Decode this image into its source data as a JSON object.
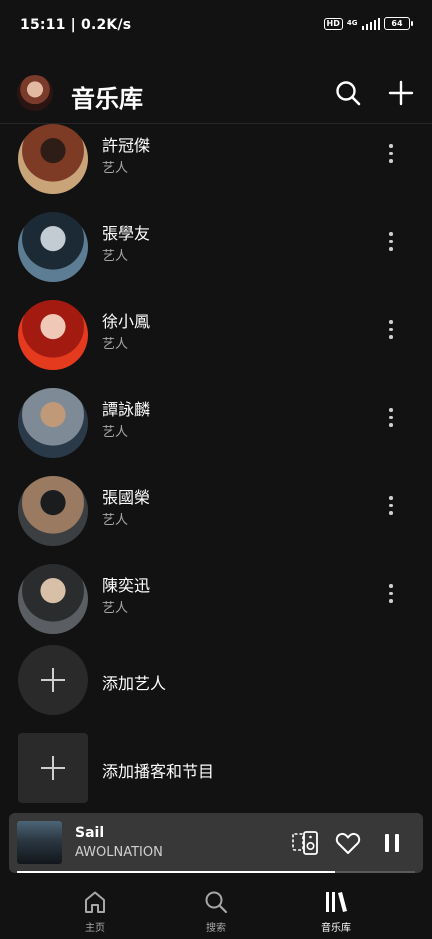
{
  "status_bar": {
    "time_speed": "15:11 | 0.2K/s",
    "hd": "HD",
    "network": "4G",
    "battery": "64"
  },
  "header": {
    "title": "音乐库",
    "icons": [
      "search-icon",
      "plus-icon"
    ]
  },
  "artists": [
    {
      "name": "許冠傑",
      "type": "艺人",
      "colors": [
        "#c9a479",
        "#7d3a24",
        "#2e1c16"
      ]
    },
    {
      "name": "張學友",
      "type": "艺人",
      "colors": [
        "#5d7d94",
        "#1c2a36",
        "#c4ccd3"
      ]
    },
    {
      "name": "徐小鳳",
      "type": "艺人",
      "colors": [
        "#e43a1e",
        "#a31a10",
        "#f0c8b8"
      ]
    },
    {
      "name": "譚詠麟",
      "type": "艺人",
      "colors": [
        "#2a3a48",
        "#7e8a96",
        "#c09a78"
      ]
    },
    {
      "name": "張國榮",
      "type": "艺人",
      "colors": [
        "#3c3f42",
        "#9a7a60",
        "#1a1c1e"
      ]
    },
    {
      "name": "陳奕迅",
      "type": "艺人",
      "colors": [
        "#5a5e62",
        "#2a2c2e",
        "#d8c0a8"
      ]
    }
  ],
  "add_items": {
    "add_artist": "添加艺人",
    "add_podcast": "添加播客和节目"
  },
  "now_playing": {
    "title": "Sail",
    "artist": "AWOLNATION",
    "progress": 0.8
  },
  "tabs": [
    {
      "label": "主页",
      "icon": "home-icon",
      "active": false
    },
    {
      "label": "搜索",
      "icon": "search-icon",
      "active": false
    },
    {
      "label": "音乐库",
      "icon": "library-icon",
      "active": true
    }
  ]
}
